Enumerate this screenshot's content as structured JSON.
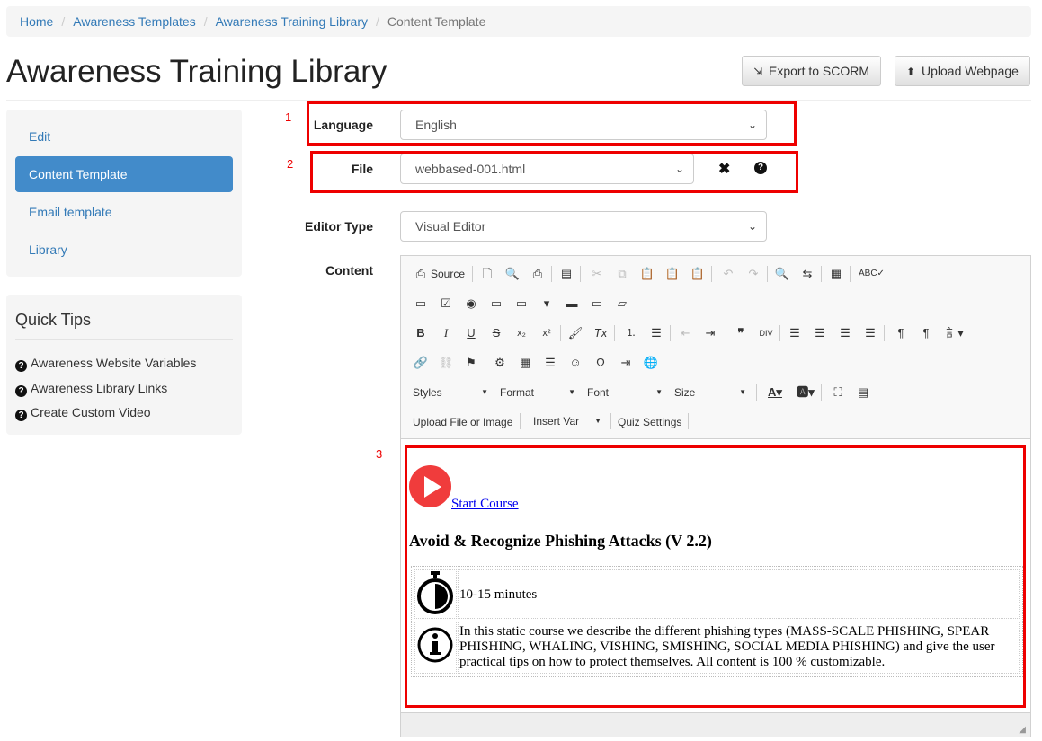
{
  "breadcrumb": {
    "items": [
      "Home",
      "Awareness Templates",
      "Awareness Training Library"
    ],
    "current": "Content Template",
    "separator": "/"
  },
  "page": {
    "title": "Awareness Training Library"
  },
  "actions": {
    "export_label": "Export to SCORM",
    "upload_label": "Upload Webpage"
  },
  "sidebar": {
    "items": [
      {
        "label": "Edit"
      },
      {
        "label": "Content Template",
        "active": true
      },
      {
        "label": "Email template"
      },
      {
        "label": "Library"
      }
    ]
  },
  "quick_tips": {
    "title": "Quick Tips",
    "links": [
      "Awareness Website Variables",
      "Awareness Library Links",
      "Create Custom Video"
    ]
  },
  "annotations": [
    "1",
    "2",
    "3"
  ],
  "form": {
    "language": {
      "label": "Language",
      "value": "English"
    },
    "file": {
      "label": "File",
      "value": "webbased-001.html"
    },
    "editor_type": {
      "label": "Editor Type",
      "value": "Visual Editor"
    },
    "content_label": "Content"
  },
  "toolbar": {
    "source_label": "Source",
    "styles_label": "Styles",
    "format_label": "Format",
    "font_label": "Font",
    "size_label": "Size",
    "upload_label": "Upload File or Image",
    "insert_var_label": "Insert Var",
    "quiz_label": "Quiz Settings"
  },
  "doc": {
    "start_course": "Start Course",
    "heading": "Avoid & Recognize Phishing Attacks (V 2.2)",
    "duration": "10-15 minutes",
    "description": "In this static course we describe the different phishing types (MASS-SCALE PHISHING, SPEAR PHISHING, WHALING, VISHING, SMISHING, SOCIAL MEDIA PHISHING) and give the user practical tips on how to protect themselves. All content is 100 % customizable."
  },
  "colors": {
    "accent": "#428bca",
    "link": "#337ab7",
    "annotation": "#e00000",
    "play": "#f03c3c"
  }
}
